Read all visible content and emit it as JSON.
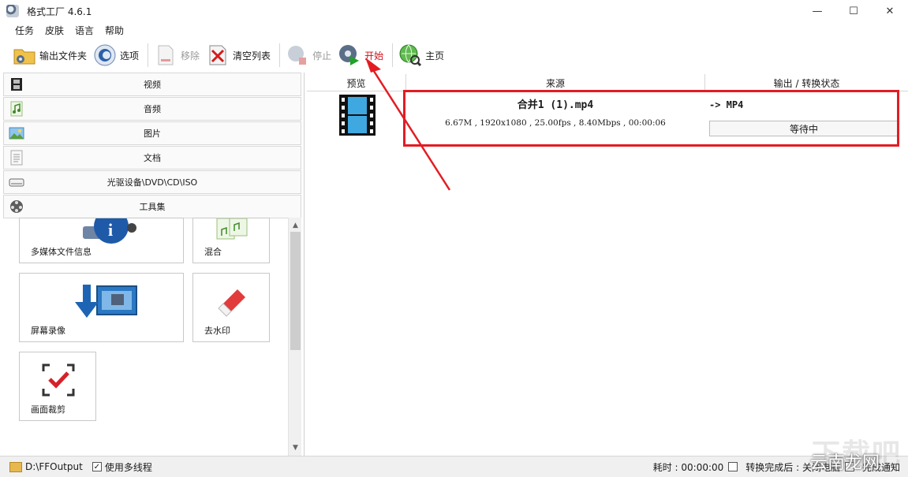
{
  "window": {
    "title": "格式工厂 4.6.1",
    "minimize": "—",
    "maximize": "☐",
    "close": "✕"
  },
  "menu": [
    "任务",
    "皮肤",
    "语言",
    "帮助"
  ],
  "toolbar": {
    "output_folder": "输出文件夹",
    "options": "选项",
    "remove": "移除",
    "clear_list": "清空列表",
    "stop": "停止",
    "start": "开始",
    "home": "主页"
  },
  "categories": [
    "视频",
    "音频",
    "图片",
    "文档",
    "光驱设备\\DVD\\CD\\ISO",
    "工具集"
  ],
  "tools": [
    "多媒体文件信息",
    "混合",
    "屏幕录像",
    "去水印",
    "画面裁剪"
  ],
  "table": {
    "headers": [
      "预览",
      "来源",
      "输出 / 转换状态"
    ],
    "rows": [
      {
        "source_name": "合并1 (1).mp4",
        "source_info": "6.67M , 1920x1080 , 25.00fps , 8.40Mbps , 00:00:06",
        "output": "-> MP4",
        "status": "等待中"
      }
    ]
  },
  "statusbar": {
    "output_path": "D:\\FFOutput",
    "multithread_label": "使用多线程",
    "elapsed": "耗时 : 00:00:00",
    "after_convert": "转换完成后 : 关闭电脑",
    "notify": "完成通知"
  },
  "watermark": {
    "text1": "下载吧",
    "text2": "云南龙网"
  },
  "colors": {
    "annotation_red": "#e31c23",
    "start_text": "#d0101a"
  }
}
